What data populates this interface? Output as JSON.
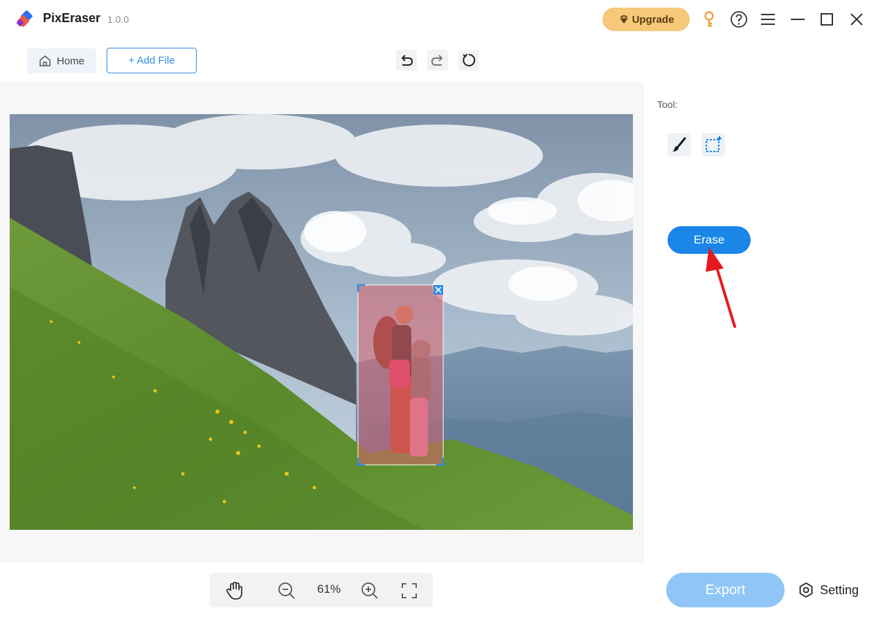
{
  "app": {
    "name": "PixEraser",
    "version": "1.0.0"
  },
  "titlebar": {
    "upgrade_label": "Upgrade",
    "icons": [
      "key-icon",
      "help-icon",
      "menu-icon",
      "minimize-icon",
      "maximize-icon",
      "close-icon"
    ]
  },
  "toolbar": {
    "home_label": "Home",
    "add_file_label": "+ Add File",
    "history": [
      "undo-icon",
      "redo-icon",
      "reset-icon"
    ]
  },
  "side_panel": {
    "tool_label": "Tool:",
    "tools": [
      "brush-icon",
      "rect-select-icon"
    ],
    "erase_label": "Erase"
  },
  "bottom": {
    "zoom_level": "61%",
    "export_label": "Export",
    "setting_label": "Setting"
  },
  "colors": {
    "accent": "#1a86e8",
    "upgrade_bg": "#f5c87a",
    "export_disabled": "#8fc6f6",
    "selection_fill": "#d9606b",
    "annotation_arrow": "#e8191e"
  }
}
